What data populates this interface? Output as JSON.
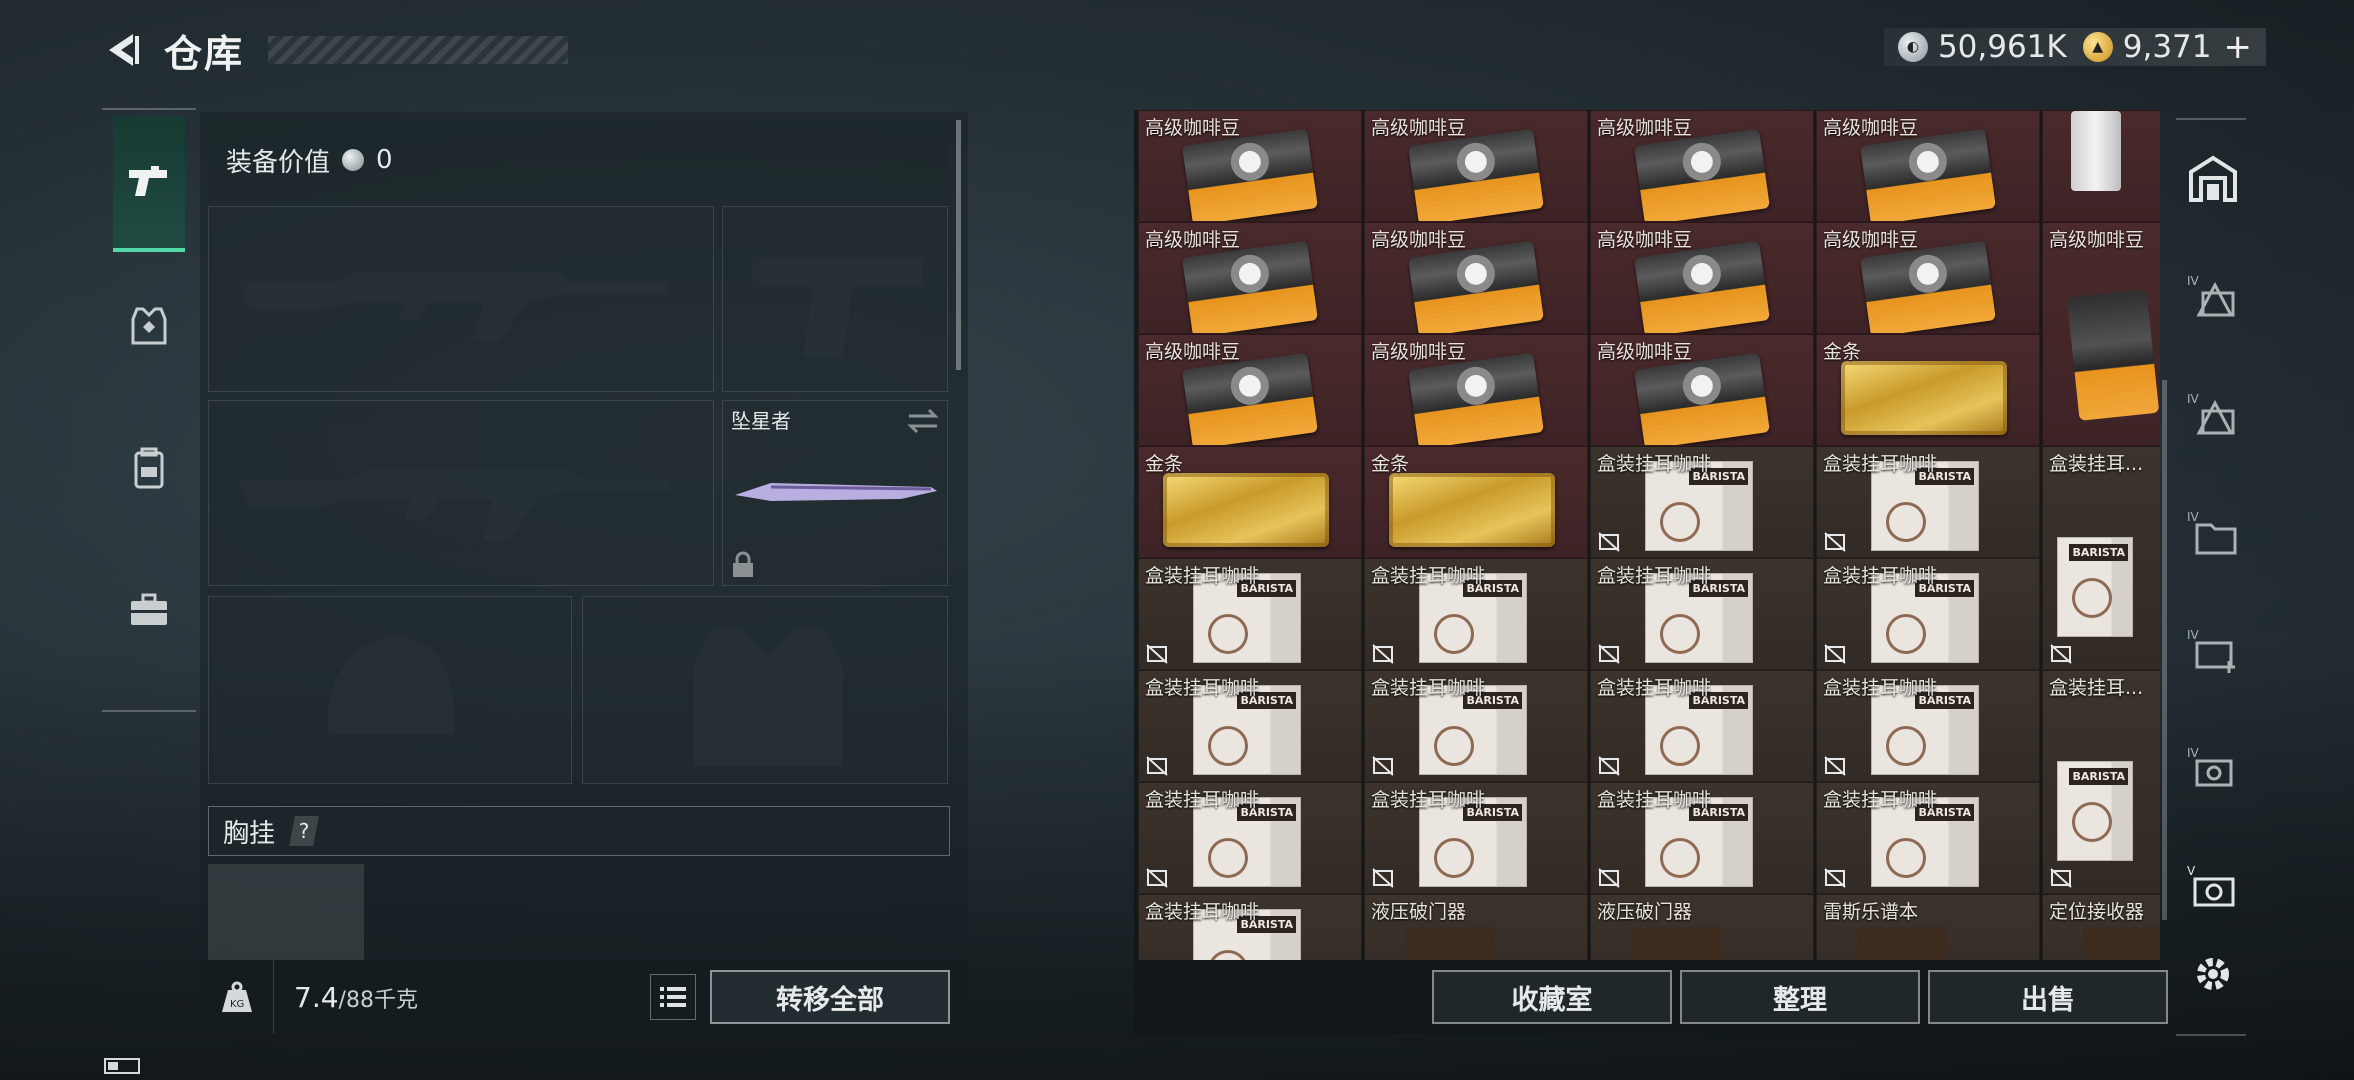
{
  "header": {
    "title": "仓库"
  },
  "currency": {
    "silver": "50,961K",
    "gold": "9,371",
    "plus": "+"
  },
  "equipment": {
    "value_label": "装备价值",
    "value": "0",
    "melee_name": "坠星者",
    "chest_label": "胸挂",
    "help": "?"
  },
  "footer_left": {
    "weight": "7.4",
    "capacity": "/88千克",
    "transfer_all": "转移全部"
  },
  "stash": {
    "items": [
      {
        "label": "高级咖啡豆",
        "kind": "bag",
        "bg": "red"
      },
      {
        "label": "高级咖啡豆",
        "kind": "bag",
        "bg": "red"
      },
      {
        "label": "高级咖啡豆",
        "kind": "bag",
        "bg": "red"
      },
      {
        "label": "高级咖啡豆",
        "kind": "bag",
        "bg": "red"
      },
      {
        "label": "",
        "kind": "can",
        "bg": "red"
      },
      {
        "label": "高级咖啡豆",
        "kind": "bag",
        "bg": "red"
      },
      {
        "label": "高级咖啡豆",
        "kind": "bag",
        "bg": "red"
      },
      {
        "label": "高级咖啡豆",
        "kind": "bag",
        "bg": "red"
      },
      {
        "label": "高级咖啡豆",
        "kind": "bag",
        "bg": "red"
      },
      {
        "label": "高级咖啡豆",
        "kind": "bag-tall",
        "bg": "red",
        "tall": true
      },
      {
        "label": "高级咖啡豆",
        "kind": "bag",
        "bg": "red"
      },
      {
        "label": "高级咖啡豆",
        "kind": "bag",
        "bg": "red"
      },
      {
        "label": "高级咖啡豆",
        "kind": "bag",
        "bg": "red"
      },
      {
        "label": "金条",
        "kind": "gold",
        "bg": "red"
      },
      {
        "label": "金条",
        "kind": "gold",
        "bg": "red"
      },
      {
        "label": "金条",
        "kind": "gold",
        "bg": "red"
      },
      {
        "label": "盒装挂耳咖啡",
        "kind": "box",
        "bg": "brown"
      },
      {
        "label": "盒装挂耳咖啡",
        "kind": "box",
        "bg": "brown"
      },
      {
        "label": "盒装挂耳...",
        "kind": "box-tall",
        "bg": "brown",
        "tall": true
      },
      {
        "label": "盒装挂耳咖啡",
        "kind": "box",
        "bg": "brown"
      },
      {
        "label": "盒装挂耳咖啡",
        "kind": "box",
        "bg": "brown"
      },
      {
        "label": "盒装挂耳咖啡",
        "kind": "box",
        "bg": "brown"
      },
      {
        "label": "盒装挂耳咖啡",
        "kind": "box",
        "bg": "brown"
      },
      {
        "label": "盒装挂耳咖啡",
        "kind": "box",
        "bg": "brown"
      },
      {
        "label": "盒装挂耳咖啡",
        "kind": "box",
        "bg": "brown"
      },
      {
        "label": "盒装挂耳咖啡",
        "kind": "box",
        "bg": "brown"
      },
      {
        "label": "盒装挂耳咖啡",
        "kind": "box",
        "bg": "brown"
      },
      {
        "label": "盒装挂耳...",
        "kind": "box-tall",
        "bg": "brown",
        "tall": true
      },
      {
        "label": "盒装挂耳咖啡",
        "kind": "box",
        "bg": "brown"
      },
      {
        "label": "盒装挂耳咖啡",
        "kind": "box",
        "bg": "brown"
      },
      {
        "label": "盒装挂耳咖啡",
        "kind": "box",
        "bg": "brown"
      },
      {
        "label": "盒装挂耳咖啡",
        "kind": "box",
        "bg": "brown"
      },
      {
        "label": "盒装挂耳咖啡",
        "kind": "box",
        "bg": "brown"
      },
      {
        "label": "液压破门器",
        "kind": "dark",
        "bg": "brown"
      },
      {
        "label": "液压破门器",
        "kind": "dark",
        "bg": "brown"
      },
      {
        "label": "雷斯乐谱本",
        "kind": "dark",
        "bg": "brown"
      },
      {
        "label": "定位接收器",
        "kind": "dark",
        "bg": "brown"
      }
    ]
  },
  "footer_right": {
    "collection": "收藏室",
    "sort": "整理",
    "sell": "出售"
  },
  "colors": {
    "accent": "#52d7a6",
    "item_red": "#4a2a2c",
    "item_brown": "#3b332c"
  }
}
